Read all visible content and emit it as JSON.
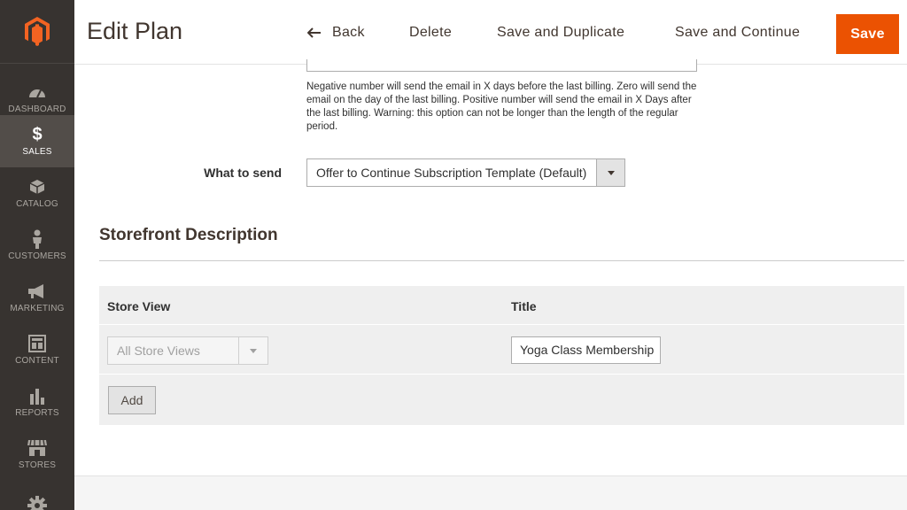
{
  "sidebar": {
    "items": [
      {
        "label": "DASHBOARD",
        "icon": "dashboard-icon"
      },
      {
        "label": "SALES",
        "icon": "dollar-icon",
        "glyph": "$"
      },
      {
        "label": "CATALOG",
        "icon": "cube-icon"
      },
      {
        "label": "CUSTOMERS",
        "icon": "person-icon"
      },
      {
        "label": "MARKETING",
        "icon": "megaphone-icon"
      },
      {
        "label": "CONTENT",
        "icon": "layout-icon"
      },
      {
        "label": "REPORTS",
        "icon": "bar-chart-icon"
      },
      {
        "label": "STORES",
        "icon": "storefront-icon"
      },
      {
        "label": "",
        "icon": "gear-icon"
      }
    ],
    "active": "SALES"
  },
  "header": {
    "title": "Edit Plan",
    "back_label": "Back",
    "delete_label": "Delete",
    "save_duplicate_label": "Save and Duplicate",
    "save_continue_label": "Save and Continue",
    "save_label": "Save",
    "accent_color": "#eb5202"
  },
  "form": {
    "note": "Negative number will send the email in X days before the last billing. Zero will send the email on the day of the last billing. Positive number will send the email in X Days after the last billing. Warning: this option can not be longer than the length of the regular period.",
    "what_to_send": {
      "label": "What to send",
      "value": "Offer to Continue Subscription Template (Default)"
    }
  },
  "storefront": {
    "section_title": "Storefront Description",
    "columns": [
      "Store View",
      "Title"
    ],
    "rows": [
      {
        "store_view": "All Store Views",
        "title": "Yoga Class Membership"
      }
    ],
    "add_label": "Add"
  }
}
